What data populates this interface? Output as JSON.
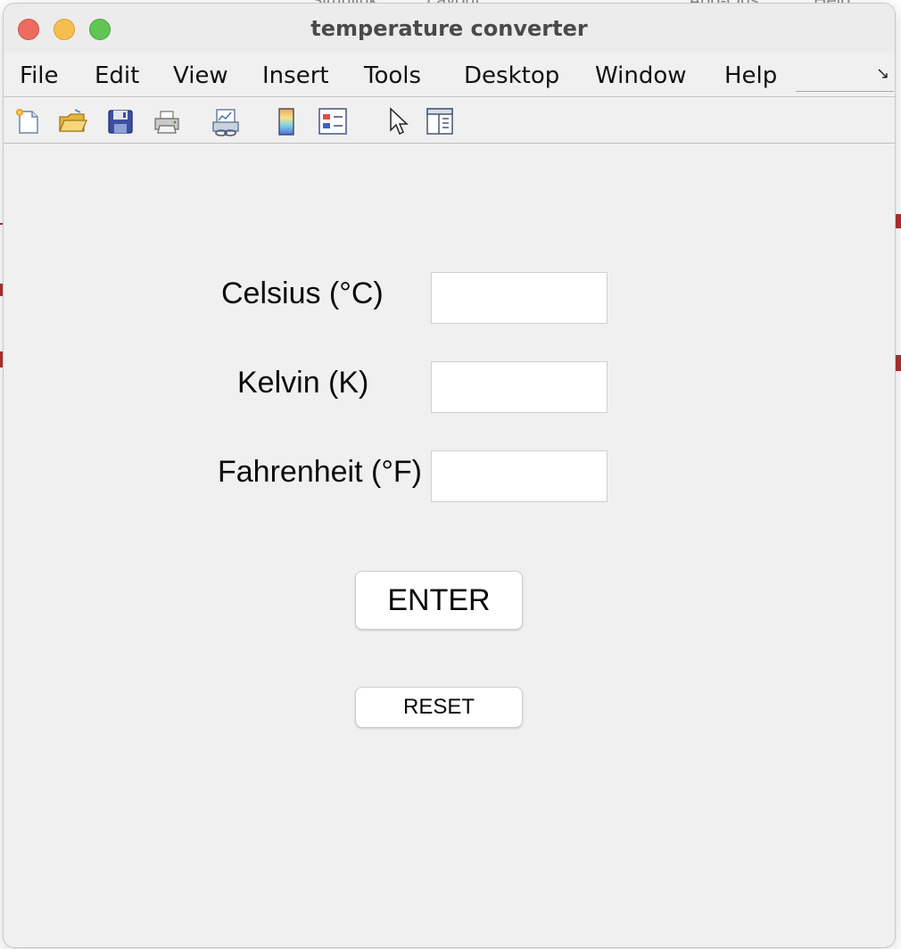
{
  "window": {
    "title": "temperature converter"
  },
  "background_fragments": [
    "Simulink",
    "Layout",
    "Add-Ons",
    "Help"
  ],
  "menubar": {
    "items": [
      "File",
      "Edit",
      "View",
      "Insert",
      "Tools",
      "Desktop",
      "Window",
      "Help"
    ]
  },
  "toolbar": {
    "icons": [
      "new-figure-icon",
      "open-file-icon",
      "save-icon",
      "print-icon",
      "link-plot-icon",
      "colorbar-icon",
      "legend-icon",
      "pointer-icon",
      "property-inspector-icon"
    ]
  },
  "form": {
    "celsius_label": "Celsius (°C)",
    "kelvin_label": "Kelvin (K)",
    "fahrenheit_label": "Fahrenheit (°F)",
    "celsius_value": "",
    "kelvin_value": "",
    "fahrenheit_value": ""
  },
  "buttons": {
    "enter_label": "ENTER",
    "reset_label": "RESET"
  },
  "colors": {
    "window_bg": "#f0f0f0",
    "close": "#ed6a5e",
    "minimize": "#f5bf4f",
    "maximize": "#61c554"
  }
}
